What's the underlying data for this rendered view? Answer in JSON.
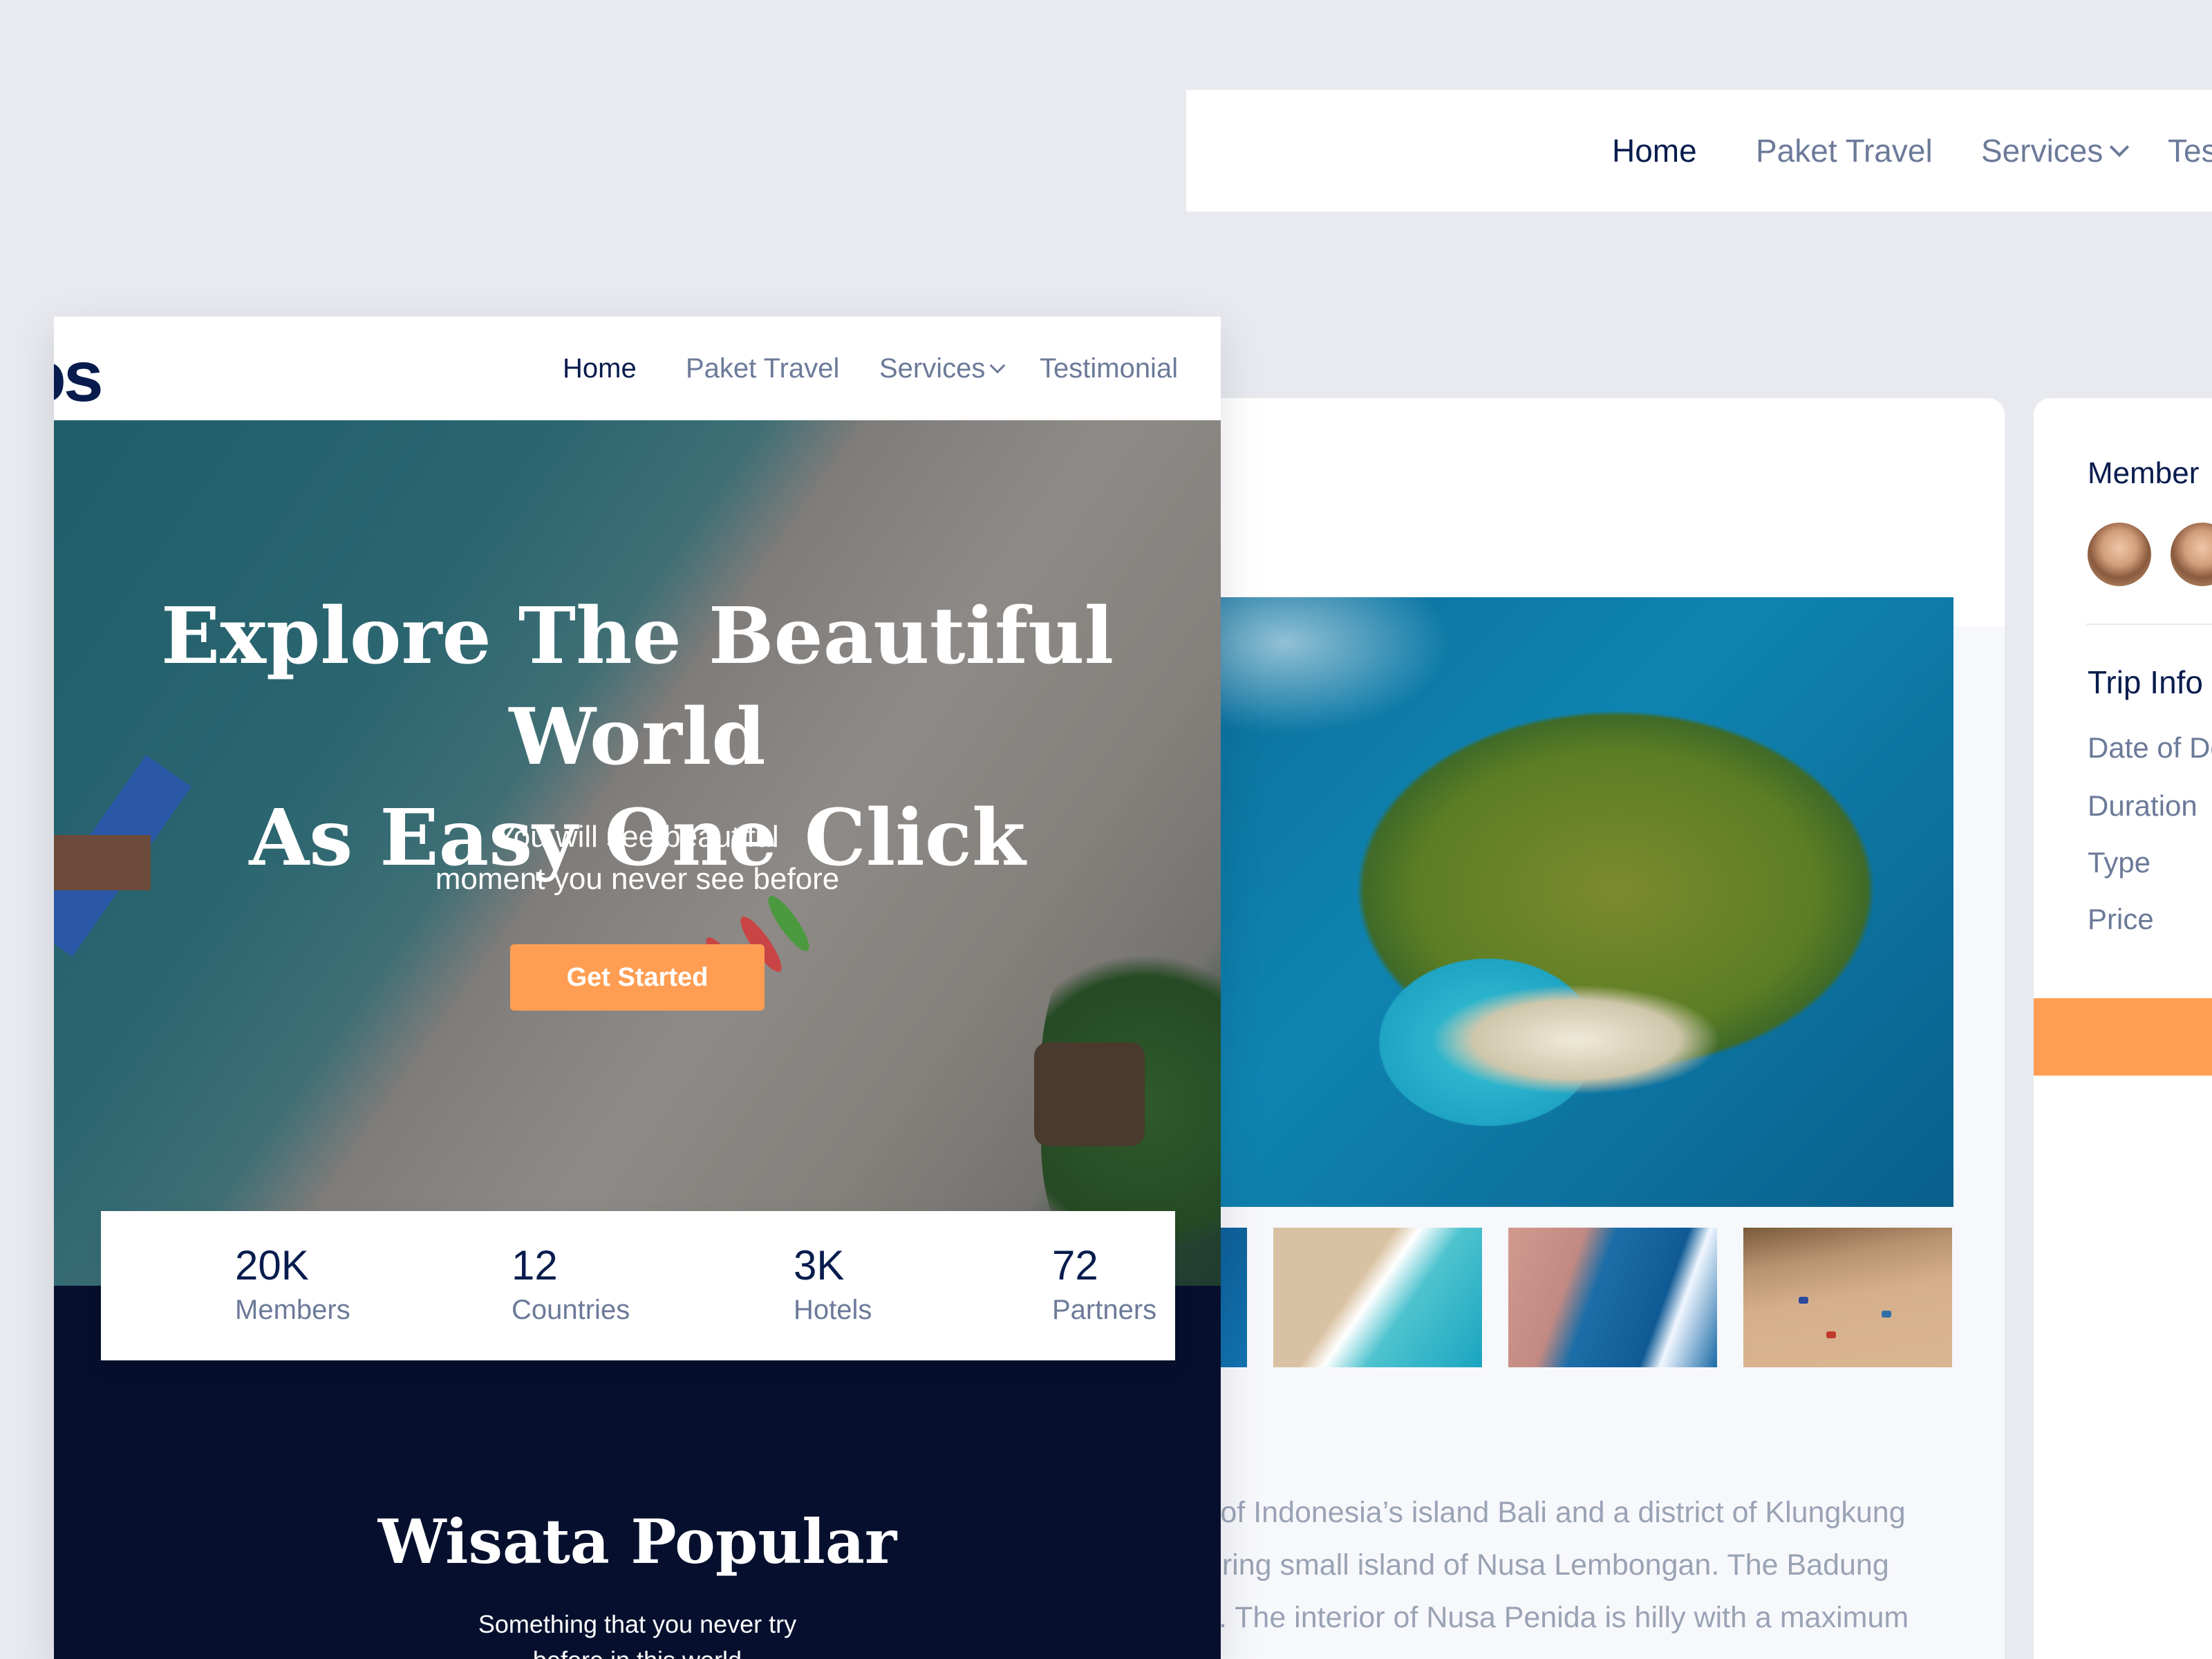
{
  "back_nav": {
    "items": [
      {
        "label": "Home",
        "active": true
      },
      {
        "label": "Paket Travel",
        "active": false
      },
      {
        "label": "Services",
        "active": false
      },
      {
        "label": "Tes",
        "active": false
      }
    ]
  },
  "detail": {
    "description_lines": [
      "st of Indonesia’s island Bali and a district of Klungkung",
      "ouring small island of Nusa Lembongan. The Badung",
      "ali. The interior of Nusa Penida is hilly with a maximum"
    ]
  },
  "sidebar": {
    "members_heading": "Member",
    "trip_info_heading": "Trip Info",
    "rows": [
      "Date of De",
      "Duration",
      "Type",
      "Price"
    ]
  },
  "front": {
    "logo": "ɔs",
    "nav": {
      "items": [
        {
          "label": "Home",
          "active": true
        },
        {
          "label": "Paket Travel",
          "active": false
        },
        {
          "label": "Services",
          "active": false
        },
        {
          "label": "Testimonial",
          "active": false
        }
      ]
    },
    "hero": {
      "title_line1": "Explore The Beautiful World",
      "title_line2": "As Easy One Click",
      "subtitle_line1": "You will see beautiful",
      "subtitle_line2": "moment you never see before",
      "cta_label": "Get Started"
    },
    "stats": [
      {
        "value": "20K",
        "label": "Members"
      },
      {
        "value": "12",
        "label": "Countries"
      },
      {
        "value": "3K",
        "label": "Hotels"
      },
      {
        "value": "72",
        "label": "Partners"
      }
    ],
    "popular": {
      "title": "Wisata Popular",
      "subtitle_line1": "Something that you never try",
      "subtitle_line2": "before in this world"
    }
  },
  "colors": {
    "navy": "#071c4d",
    "accent": "#ff9e53",
    "dark_section": "#06102e"
  }
}
